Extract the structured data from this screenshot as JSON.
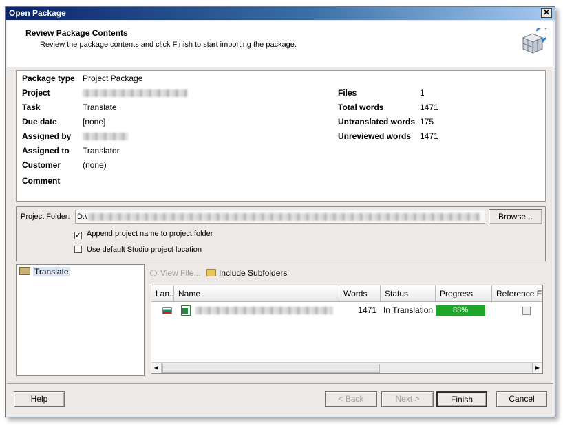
{
  "window": {
    "title": "Open Package",
    "close_glyph": "✕"
  },
  "header": {
    "title": "Review Package Contents",
    "subtitle": "Review the package contents and click Finish to start importing the package.",
    "icon": "package-import-icon"
  },
  "summary": {
    "package_type_label": "Package type",
    "package_type_value": "Project Package",
    "project_label": "Project",
    "task_label": "Task",
    "task_value": "Translate",
    "due_date_label": "Due date",
    "due_date_value": "[none]",
    "assigned_by_label": "Assigned by",
    "assigned_to_label": "Assigned to",
    "assigned_to_value": "Translator",
    "customer_label": "Customer",
    "customer_value": "(none)",
    "comment_label": "Comment",
    "files_label": "Files",
    "files_value": "1",
    "total_words_label": "Total words",
    "total_words_value": "1471",
    "untranslated_label": "Untranslated words",
    "untranslated_value": "175",
    "unreviewed_label": "Unreviewed words",
    "unreviewed_value": "1471"
  },
  "folder": {
    "label": "Project Folder:",
    "value_prefix": "D:\\",
    "browse_label": "Browse...",
    "append_label": "Append project name to project folder",
    "append_checked": true,
    "default_label": "Use default Studio project location",
    "default_checked": false
  },
  "tree": {
    "items": [
      {
        "label": "Translate"
      }
    ]
  },
  "toolbar": {
    "view_file": "View File...",
    "include_subfolders": "Include Subfolders"
  },
  "file_list": {
    "columns": [
      "Lan...",
      "Name",
      "Words",
      "Status",
      "Progress",
      "Reference Fi"
    ],
    "rows": [
      {
        "words": "1471",
        "status": "In Translation",
        "progress_label": "88%",
        "progress": 0.88,
        "reference": false
      }
    ]
  },
  "footer": {
    "help": "Help",
    "back": "< Back",
    "next": "Next >",
    "finish": "Finish",
    "cancel": "Cancel"
  },
  "colors": {
    "accent": "#0a246a",
    "progress": "#1fa62a"
  }
}
